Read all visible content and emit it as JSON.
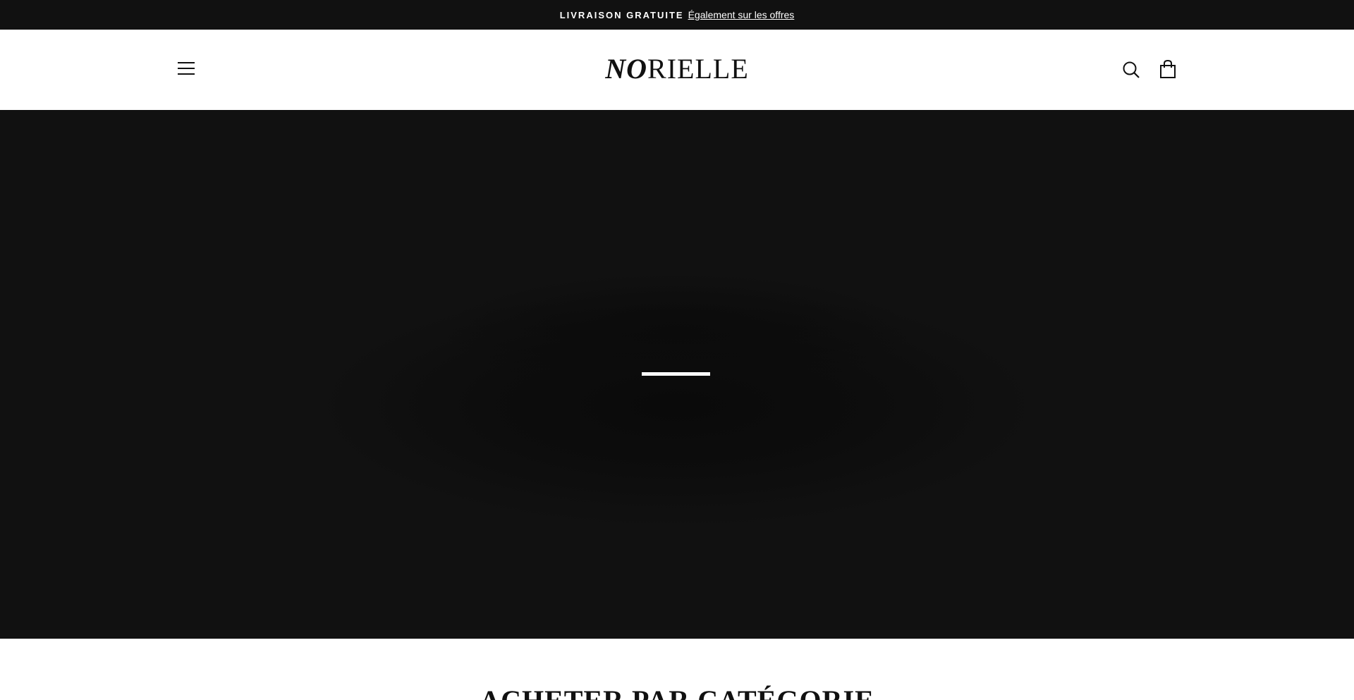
{
  "announcement": {
    "bold_text": "LIVRAISON GRATUITE",
    "link_text": "Également sur les offres"
  },
  "header": {
    "logo_italic": "NO",
    "logo_rest": "RIELLE",
    "menu_icon": "hamburger-menu-icon",
    "search_icon": "search-icon",
    "cart_icon": "shopping-bag-icon"
  },
  "hero": {
    "background_color": "#111111",
    "state": "loading"
  },
  "section": {
    "title": "ACHETER PAR CATÉGORIE"
  },
  "colors": {
    "announcement_bg": "#111111",
    "header_bg": "#ffffff",
    "text": "#111111"
  }
}
